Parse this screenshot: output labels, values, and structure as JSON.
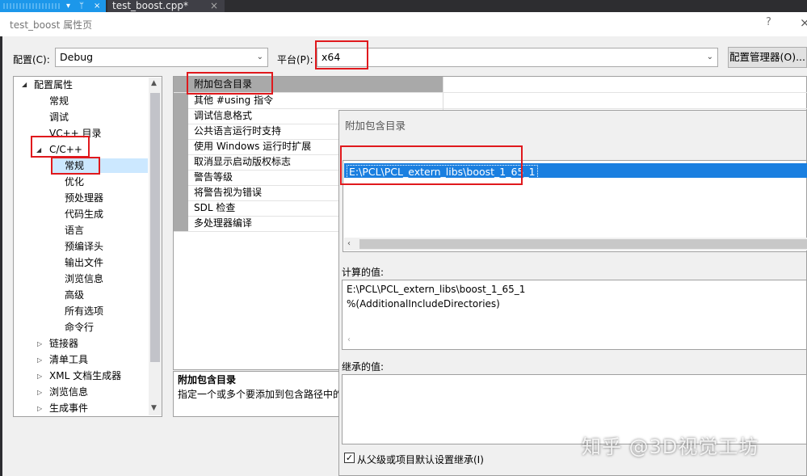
{
  "ide": {
    "pin_icon": "pin-icon",
    "document_tab": "test_boost.cpp*",
    "tab_close": "×"
  },
  "window": {
    "title": "test_boost 属性页",
    "help": "?",
    "close": "×"
  },
  "config": {
    "label": "配置(C):",
    "value": "Debug"
  },
  "platform": {
    "label": "平台(P):",
    "value": "x64"
  },
  "config_manager_button": "配置管理器(O)...",
  "tree": {
    "root": "配置属性",
    "items": [
      "常规",
      "调试",
      "VC++ 目录"
    ],
    "cpp": {
      "label": "C/C++",
      "children": [
        "常规",
        "优化",
        "预处理器",
        "代码生成",
        "语言",
        "预编译头",
        "输出文件",
        "浏览信息",
        "高级",
        "所有选项",
        "命令行"
      ]
    },
    "collapsed": [
      "链接器",
      "清单工具",
      "XML 文档生成器",
      "浏览信息",
      "生成事件"
    ],
    "selected": "常规"
  },
  "grid": {
    "rows": [
      "附加包含目录",
      "其他 #using 指令",
      "调试信息格式",
      "公共语言运行时支持",
      "使用 Windows 运行时扩展",
      "取消显示启动版权标志",
      "警告等级",
      "将警告视为错误",
      "SDL 检查",
      "多处理器编译"
    ],
    "selected_row": "附加包含目录"
  },
  "description": {
    "title": "附加包含目录",
    "text": "指定一个或多个要添加到包含路径中的"
  },
  "popup": {
    "title": "附加包含目录",
    "list_value": "E:\\PCL\\PCL_extern_libs\\boost_1_65_1",
    "computed_label": "计算的值:",
    "computed_lines": [
      "E:\\PCL\\PCL_extern_libs\\boost_1_65_1",
      "%(AdditionalIncludeDirectories)"
    ],
    "inherited_label": "继承的值:",
    "checkbox_label": "从父级或项目默认设置继承(I)",
    "checkbox_checked": true,
    "checkbox_mark": "✓"
  },
  "watermark": "知乎 @3D视觉工坊",
  "colors": {
    "highlight": "#e0191d",
    "selection": "#1a7fe0",
    "tree_selection": "#cce8ff"
  }
}
